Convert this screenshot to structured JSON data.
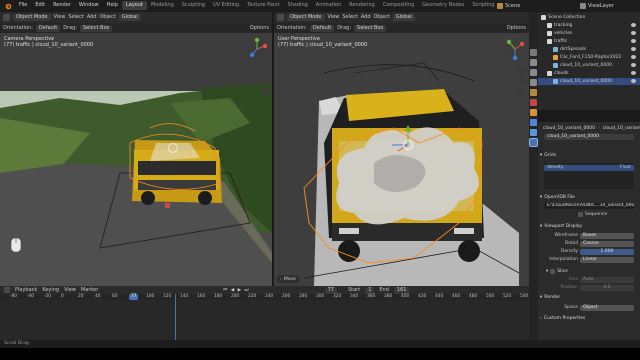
{
  "menu": {
    "items": [
      "File",
      "Edit",
      "Render",
      "Window",
      "Help"
    ],
    "workspaces": [
      "Layout",
      "Modeling",
      "Sculpting",
      "UV Editing",
      "Texture Paint",
      "Shading",
      "Animation",
      "Rendering",
      "Compositing",
      "Geometry Nodes",
      "Scripting"
    ],
    "scene": "Scene",
    "view_layer": "ViewLayer"
  },
  "left_view": {
    "mode": "Object Mode",
    "menu": [
      "View",
      "Select",
      "Add",
      "Object"
    ],
    "transform": "Global",
    "orientation_label": "Orientation:",
    "orientation": "Default",
    "drag_label": "Drag:",
    "drag": "Select Box",
    "options": "Options",
    "title": "Camera Perspective",
    "subtitle": "(77) traffic | cloud_10_variant_0000"
  },
  "right_view": {
    "mode": "Object Mode",
    "menu": [
      "View",
      "Select",
      "Add",
      "Object"
    ],
    "transform": "Global",
    "orientation_label": "Orientation:",
    "orientation": "Default",
    "drag_label": "Drag:",
    "drag": "Select Box",
    "options": "Options",
    "title": "User Perspective",
    "subtitle": "(77) traffic | cloud_10_variant_0000",
    "move_label": "Move"
  },
  "outliner": {
    "root": "Scene Collection",
    "rows": [
      {
        "label": "tracking",
        "depth": 1
      },
      {
        "label": "vehicles",
        "depth": 1
      },
      {
        "label": "traffic",
        "depth": 1
      },
      {
        "label": "dirtSpreads",
        "depth": 2
      },
      {
        "label": "Car_Ford_F150-Raptor2022",
        "depth": 2
      },
      {
        "label": "cloud_10_variant_0000",
        "depth": 2
      },
      {
        "label": "clouds",
        "depth": 1
      },
      {
        "label": "cloud_10_variant_0000",
        "depth": 2,
        "selected": true
      }
    ]
  },
  "properties": {
    "object_name": "cloud_10_variant_0000",
    "data_name": "cloud_10_variant_0000",
    "grids_section": "Grids",
    "grid_row": "density",
    "grid_type": "Float",
    "openvdb_section": "OpenVDB File",
    "file_path": "E:\\CloudRecon\\VDB\\C...10_variant_0000.vdb",
    "sequence_label": "Sequence",
    "viewport_display_section": "Viewport Display",
    "fields": [
      {
        "label": "Wireframe",
        "value": "Boxes"
      },
      {
        "label": "Detail",
        "value": "Coarse"
      },
      {
        "label": "Density",
        "value": "1.000"
      },
      {
        "label": "Interpolation",
        "value": "Linear"
      }
    ],
    "slice_label": "Slice",
    "axis_label": "Axis",
    "axis_value": "Auto",
    "position_label": "Position",
    "position_value": "0.5",
    "render_section": "Render",
    "space_label": "Space",
    "space_value": "Object",
    "custom_section": "Custom Properties"
  },
  "timeline": {
    "menu": [
      "Playback",
      "Keying",
      "View",
      "Marker"
    ],
    "current_frame": "77",
    "start_label": "Start",
    "start": "1",
    "end_label": "End",
    "end": "161",
    "ticks": [
      "-80",
      "-40",
      "-20",
      "0",
      "20",
      "40",
      "60",
      "77",
      "100",
      "120",
      "140",
      "160",
      "180",
      "200",
      "220",
      "240",
      "260",
      "280",
      "300",
      "320",
      "340",
      "360",
      "380",
      "400",
      "420",
      "440",
      "460",
      "480",
      "500",
      "520",
      "540"
    ]
  },
  "status": "Scroll Drag",
  "colors": {
    "accent": "#4772b3",
    "selection": "#ff8c1a",
    "truck_yellow": "#e8c21a",
    "header": "#2b2b2b",
    "panel": "#303030"
  }
}
